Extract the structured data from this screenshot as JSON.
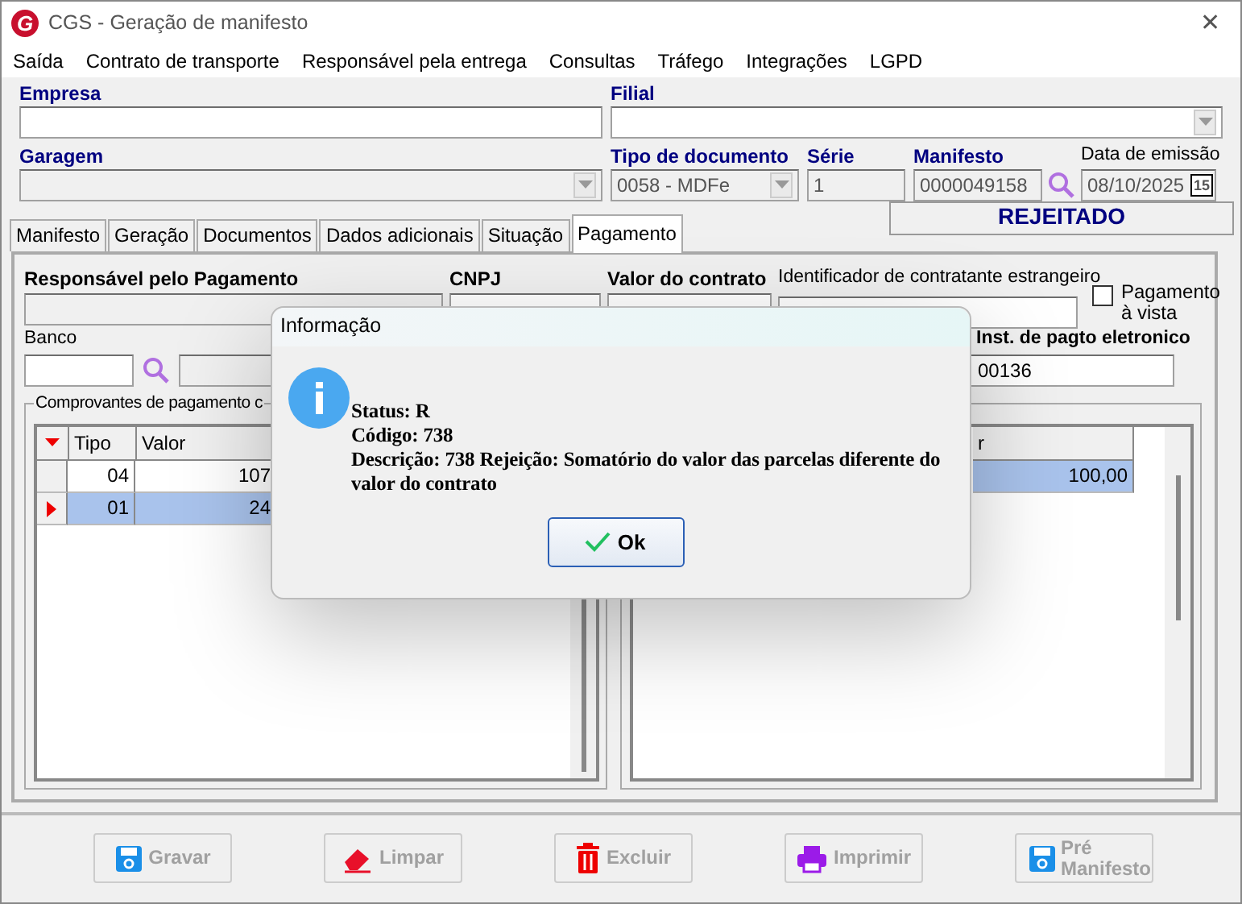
{
  "window": {
    "title": "CGS - Geração de manifesto",
    "logo": "G",
    "close": "✕"
  },
  "menu": [
    "Saída",
    "Contrato de transporte",
    "Responsável pela entrega",
    "Consultas",
    "Tráfego",
    "Integrações",
    "LGPD"
  ],
  "header": {
    "empresa_label": "Empresa",
    "filial_label": "Filial",
    "garagem_label": "Garagem",
    "tipo_label": "Tipo de documento",
    "tipo_value": "0058 - MDFe",
    "serie_label": "Série",
    "serie_value": "1",
    "manifesto_label": "Manifesto",
    "manifesto_value": "0000049158",
    "data_label": "Data de emissão",
    "data_value": "08/10/2025",
    "calendar": "15"
  },
  "tabs": [
    {
      "label": "Manifesto",
      "selected": false
    },
    {
      "label": "Geração",
      "selected": false
    },
    {
      "label": "Documentos",
      "selected": false
    },
    {
      "label": "Dados adicionais",
      "selected": false
    },
    {
      "label": "Situação",
      "selected": false
    },
    {
      "label": "Pagamento",
      "selected": true
    }
  ],
  "status": "REJEITADO",
  "payment": {
    "responsavel_label": "Responsável pelo Pagamento",
    "cnpj_label": "CNPJ",
    "valor_label": "Valor do contrato",
    "identificador_label": "Identificador de contratante estrangeiro",
    "avista": {
      "label": "Pagamento à vista",
      "checked": false
    },
    "banco_label": "Banco",
    "inst_label": "Inst. de pagto eletronico",
    "inst_value": "00136",
    "group_label": "Comprovantes de pagamento c",
    "left_grid": {
      "columns": [
        "Tipo",
        "Valor"
      ],
      "rows": [
        {
          "cells": [
            "04",
            "107"
          ],
          "selected": false
        },
        {
          "cells": [
            "01",
            "24"
          ],
          "selected": true
        }
      ]
    },
    "right_grid": {
      "columns": [
        "r"
      ],
      "rows": [
        {
          "cells": [
            "100,00"
          ],
          "selected": true
        }
      ]
    }
  },
  "buttons": [
    {
      "label": "Gravar",
      "kind": "save",
      "disabled": true
    },
    {
      "label": "Limpar",
      "kind": "eraser",
      "disabled": true
    },
    {
      "label": "Excluir",
      "kind": "trash",
      "disabled": true
    },
    {
      "label": "Imprimir",
      "kind": "printer",
      "disabled": true
    },
    {
      "label": "Pré Manifesto",
      "kind": "save",
      "disabled": true
    }
  ],
  "dialog": {
    "title": "Informação",
    "lines": [
      "Status: R",
      "Código: 738",
      "Descrição: 738 Rejeição: Somatório do valor das parcelas diferente do valor do contrato"
    ],
    "ok": "Ok"
  }
}
